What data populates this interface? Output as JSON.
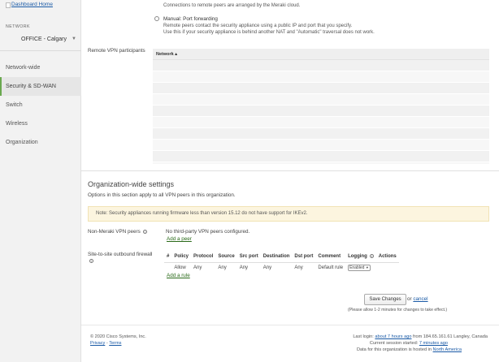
{
  "sidebar": {
    "logo_alt": "Dashboard Home",
    "network_label": "NETWORK",
    "network_name": "OFFICE - Calgary",
    "items": [
      {
        "label": "Network-wide"
      },
      {
        "label": "Security & SD-WAN"
      },
      {
        "label": "Switch"
      },
      {
        "label": "Wireless"
      },
      {
        "label": "Organization"
      }
    ]
  },
  "nat": {
    "cloud_text": "Connections to remote peers are arranged by the Meraki cloud.",
    "manual_label": "Manual: Port forwarding",
    "manual_desc1": "Remote peers contact the security appliance using a public IP and port that you specify.",
    "manual_desc2": "Use this if your security appliance is behind another NAT and \"Automatic\" traversal does not work."
  },
  "remote_vpn": {
    "label": "Remote VPN participants",
    "column": "Network ▴"
  },
  "org_settings": {
    "title": "Organization-wide settings",
    "desc": "Options in this section apply to all VPN peers in this organization.",
    "note": "Note: Security appliances running firmware less than version 15.12 do not have support for IKEv2."
  },
  "non_meraki": {
    "label": "Non-Meraki VPN peers",
    "status": "No third-party VPN peers configured.",
    "add_link": "Add a peer"
  },
  "firewall": {
    "label": "Site-to-site outbound firewall",
    "headers": [
      "#",
      "Policy",
      "Protocol",
      "Source",
      "Src port",
      "Destination",
      "Dst port",
      "Comment",
      "Logging",
      "Actions"
    ],
    "row": {
      "num": "",
      "policy": "Allow",
      "protocol": "Any",
      "source": "Any",
      "src_port": "Any",
      "destination": "Any",
      "dst_port": "Any",
      "comment": "Default rule",
      "logging": "Enabled"
    },
    "add_link": "Add a rule"
  },
  "save": {
    "button": "Save Changes",
    "or": "or",
    "cancel": "cancel",
    "note": "(Please allow 1-2 minutes for changes to take effect.)"
  },
  "footer": {
    "copyright": "© 2020 Cisco Systems, Inc.",
    "privacy": "Privacy",
    "sep": " - ",
    "terms": "Terms",
    "last_login_prefix": "Last login: ",
    "last_login_link": "about 7 hours ago",
    "last_login_suffix": " from 184.65.161.61 Langley, Canada",
    "session_prefix": "Current session started: ",
    "session_link": "7 minutes ago",
    "hosted_prefix": "Data for this organization is hosted in ",
    "hosted_link": "North America"
  }
}
